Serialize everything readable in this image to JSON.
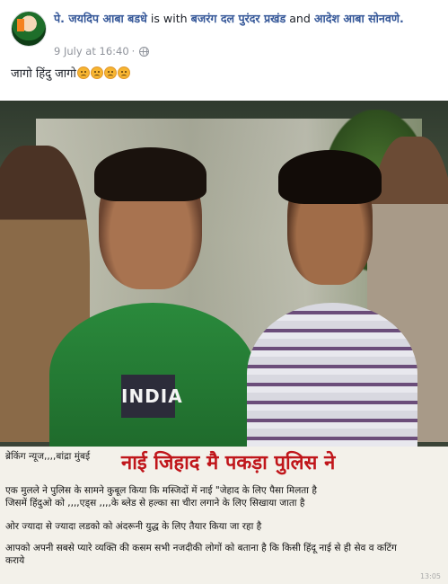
{
  "post": {
    "author": "पे. जयदिप आबा बडधे",
    "with_text": "is with",
    "tagged_1": "बजरंग दल पुरंदर प्रखंड",
    "and_text": "and",
    "tagged_2": "आदेश आबा सोनवणे.",
    "timestamp": "9 July at 16:40",
    "privacy_sep": "·",
    "privacy_icon": "globe-icon",
    "text": "जागो हिंदु जागो",
    "emoji_count": 4,
    "emoji_name": "frowning-face"
  },
  "image": {
    "shirt_text": "INDIA",
    "caption": {
      "tag": "ब्रेकिंग न्यूज,,,,बांद्रा मुंबई",
      "headline": "नाई जिहाद मै पकड़ा पुलिस ने",
      "line1": "एक मुलले ने पुलिस के सामने कुबूल किया कि मस्जिदों में नाई \"जेहाद के लिए पैसा मिलता है",
      "line2": "जिसमें हिंदुओ को ,,,,एड्स ,,,,के ब्लेड से हल्का सा चीरा लगाने के लिए सिखाया जाता है",
      "line3": "ओर ज्यादा से ज्यादा लडको को अंदरूनी युद्ध के लिए तैयार किया जा रहा है",
      "line4": "आपको अपनी सबसे प्यारे व्यक्ति की कसम सभी नजदीकी लोगों को बताना है कि किसी हिंदू नाई से ही सेव व कटिंग",
      "line5": "कराये",
      "stamp": "13:05"
    }
  }
}
